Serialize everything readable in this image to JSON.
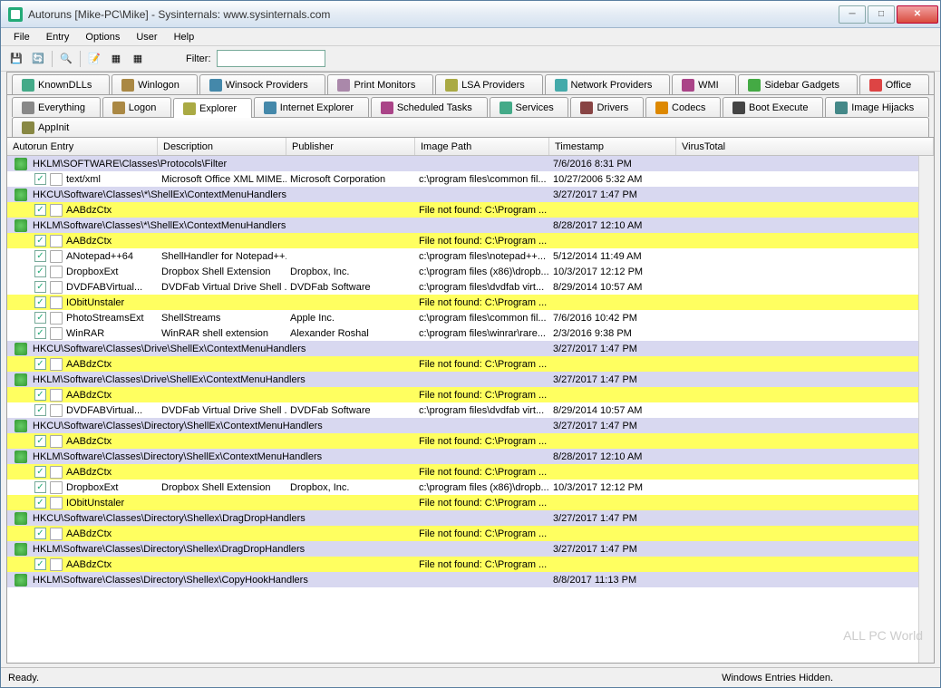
{
  "title": "Autoruns [Mike-PC\\Mike] - Sysinternals: www.sysinternals.com",
  "menus": [
    "File",
    "Entry",
    "Options",
    "User",
    "Help"
  ],
  "filter_label": "Filter:",
  "filter_value": "",
  "tabs_row1": [
    {
      "label": "KnownDLLs",
      "color": "#4a8"
    },
    {
      "label": "Winlogon",
      "color": "#a84"
    },
    {
      "label": "Winsock Providers",
      "color": "#48a"
    },
    {
      "label": "Print Monitors",
      "color": "#a8a"
    },
    {
      "label": "LSA Providers",
      "color": "#aa4"
    },
    {
      "label": "Network Providers",
      "color": "#4aa"
    },
    {
      "label": "WMI",
      "color": "#a48"
    },
    {
      "label": "Sidebar Gadgets",
      "color": "#4a4"
    },
    {
      "label": "Office",
      "color": "#d44"
    }
  ],
  "tabs_row2": [
    {
      "label": "Everything",
      "color": "#888",
      "active": false
    },
    {
      "label": "Logon",
      "color": "#a84",
      "active": false
    },
    {
      "label": "Explorer",
      "color": "#aa4",
      "active": true
    },
    {
      "label": "Internet Explorer",
      "color": "#48a",
      "active": false
    },
    {
      "label": "Scheduled Tasks",
      "color": "#a48",
      "active": false
    },
    {
      "label": "Services",
      "color": "#4a8",
      "active": false
    },
    {
      "label": "Drivers",
      "color": "#844",
      "active": false
    },
    {
      "label": "Codecs",
      "color": "#d80",
      "active": false
    },
    {
      "label": "Boot Execute",
      "color": "#444",
      "active": false
    },
    {
      "label": "Image Hijacks",
      "color": "#488",
      "active": false
    },
    {
      "label": "AppInit",
      "color": "#884",
      "active": false
    }
  ],
  "columns": [
    "Autorun Entry",
    "Description",
    "Publisher",
    "Image Path",
    "Timestamp",
    "VirusTotal"
  ],
  "rows": [
    {
      "type": "group",
      "entry": "HKLM\\SOFTWARE\\Classes\\Protocols\\Filter",
      "time": "7/6/2016 8:31 PM"
    },
    {
      "type": "item",
      "entry": "text/xml",
      "desc": "Microsoft Office XML MIME...",
      "pub": "Microsoft Corporation",
      "path": "c:\\program files\\common fil...",
      "time": "10/27/2006 5:32 AM"
    },
    {
      "type": "group",
      "entry": "HKCU\\Software\\Classes\\*\\ShellEx\\ContextMenuHandlers",
      "time": "3/27/2017 1:47 PM"
    },
    {
      "type": "item",
      "yellow": true,
      "entry": "AABdzCtx",
      "path": "File not found: C:\\Program ..."
    },
    {
      "type": "group",
      "entry": "HKLM\\Software\\Classes\\*\\ShellEx\\ContextMenuHandlers",
      "time": "8/28/2017 12:10 AM"
    },
    {
      "type": "item",
      "yellow": true,
      "entry": "AABdzCtx",
      "path": "File not found: C:\\Program ..."
    },
    {
      "type": "item",
      "entry": "ANotepad++64",
      "desc": "ShellHandler for Notepad++...",
      "path": "c:\\program files\\notepad++...",
      "time": "5/12/2014 11:49 AM"
    },
    {
      "type": "item",
      "entry": "DropboxExt",
      "desc": "Dropbox Shell Extension",
      "pub": "Dropbox, Inc.",
      "path": "c:\\program files (x86)\\dropb...",
      "time": "10/3/2017 12:12 PM"
    },
    {
      "type": "item",
      "entry": "DVDFABVirtual...",
      "desc": "DVDFab Virtual Drive Shell ...",
      "pub": "DVDFab Software",
      "path": "c:\\program files\\dvdfab virt...",
      "time": "8/29/2014 10:57 AM"
    },
    {
      "type": "item",
      "yellow": true,
      "entry": "IObitUnstaler",
      "path": "File not found: C:\\Program ..."
    },
    {
      "type": "item",
      "entry": "PhotoStreamsExt",
      "desc": "ShellStreams",
      "pub": "Apple Inc.",
      "path": "c:\\program files\\common fil...",
      "time": "7/6/2016 10:42 PM"
    },
    {
      "type": "item",
      "entry": "WinRAR",
      "desc": "WinRAR shell extension",
      "pub": "Alexander Roshal",
      "path": "c:\\program files\\winrar\\rare...",
      "time": "2/3/2016 9:38 PM"
    },
    {
      "type": "group",
      "entry": "HKCU\\Software\\Classes\\Drive\\ShellEx\\ContextMenuHandlers",
      "time": "3/27/2017 1:47 PM"
    },
    {
      "type": "item",
      "yellow": true,
      "entry": "AABdzCtx",
      "path": "File not found: C:\\Program ..."
    },
    {
      "type": "group",
      "entry": "HKLM\\Software\\Classes\\Drive\\ShellEx\\ContextMenuHandlers",
      "time": "3/27/2017 1:47 PM"
    },
    {
      "type": "item",
      "yellow": true,
      "entry": "AABdzCtx",
      "path": "File not found: C:\\Program ..."
    },
    {
      "type": "item",
      "entry": "DVDFABVirtual...",
      "desc": "DVDFab Virtual Drive Shell ...",
      "pub": "DVDFab Software",
      "path": "c:\\program files\\dvdfab virt...",
      "time": "8/29/2014 10:57 AM"
    },
    {
      "type": "group",
      "entry": "HKCU\\Software\\Classes\\Directory\\ShellEx\\ContextMenuHandlers",
      "time": "3/27/2017 1:47 PM"
    },
    {
      "type": "item",
      "yellow": true,
      "entry": "AABdzCtx",
      "path": "File not found: C:\\Program ..."
    },
    {
      "type": "group",
      "entry": "HKLM\\Software\\Classes\\Directory\\ShellEx\\ContextMenuHandlers",
      "time": "8/28/2017 12:10 AM"
    },
    {
      "type": "item",
      "yellow": true,
      "entry": "AABdzCtx",
      "path": "File not found: C:\\Program ..."
    },
    {
      "type": "item",
      "entry": "DropboxExt",
      "desc": "Dropbox Shell Extension",
      "pub": "Dropbox, Inc.",
      "path": "c:\\program files (x86)\\dropb...",
      "time": "10/3/2017 12:12 PM"
    },
    {
      "type": "item",
      "yellow": true,
      "entry": "IObitUnstaler",
      "path": "File not found: C:\\Program ..."
    },
    {
      "type": "group",
      "entry": "HKCU\\Software\\Classes\\Directory\\Shellex\\DragDropHandlers",
      "time": "3/27/2017 1:47 PM"
    },
    {
      "type": "item",
      "yellow": true,
      "entry": "AABdzCtx",
      "path": "File not found: C:\\Program ..."
    },
    {
      "type": "group",
      "entry": "HKLM\\Software\\Classes\\Directory\\Shellex\\DragDropHandlers",
      "time": "3/27/2017 1:47 PM"
    },
    {
      "type": "item",
      "yellow": true,
      "entry": "AABdzCtx",
      "path": "File not found: C:\\Program ..."
    },
    {
      "type": "group",
      "entry": "HKLM\\Software\\Classes\\Directory\\Shellex\\CopyHookHandlers",
      "time": "8/8/2017 11:13 PM"
    }
  ],
  "status_left": "Ready.",
  "status_right": "Windows Entries Hidden.",
  "watermark": "ALL PC World"
}
